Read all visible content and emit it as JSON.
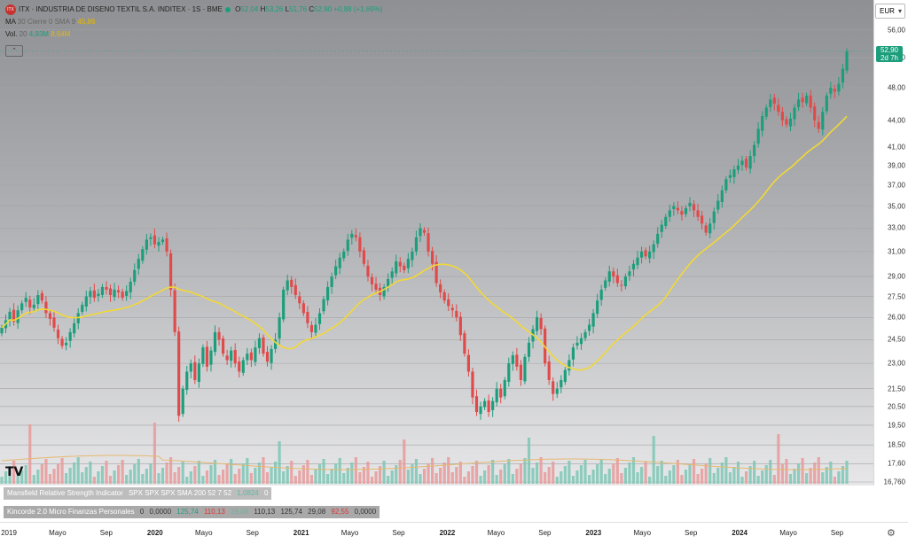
{
  "header": {
    "symbol_title": "ITX · INDUSTRIA DE DISENO TEXTIL S.A. INDITEX · 1S · BME",
    "logo_text": "ITX",
    "o_label": "O",
    "o_value": "52,04",
    "h_label": "H",
    "h_value": "53,26",
    "l_label": "L",
    "l_value": "51,76",
    "c_label": "C",
    "c_value": "52,90",
    "change": "+0,88 (+1,69%)",
    "ma_label": "MA",
    "ma_params": "30 Cierre 0 SMA 9",
    "ma_value": "45,86",
    "vol_label": "Vol.",
    "vol_param": "20",
    "vol_value1": "4,93M",
    "vol_value2": "8,64M",
    "collapse_icon": "chevron-up"
  },
  "currency": "EUR",
  "last_price": "52,90",
  "countdown": "2d 7h",
  "y_ticks": [
    "56,00",
    "52,00",
    "48,00",
    "44,00",
    "41,00",
    "39,00",
    "37,00",
    "35,00",
    "33,00",
    "31,00",
    "29,00",
    "27,50",
    "26,00",
    "24,50",
    "23,00",
    "21,50",
    "20,50",
    "19,50",
    "18,50",
    "17,60",
    "16,760"
  ],
  "x_ticks": [
    {
      "label": "2019",
      "bold": false
    },
    {
      "label": "Mayo",
      "bold": false
    },
    {
      "label": "Sep",
      "bold": false
    },
    {
      "label": "2020",
      "bold": true
    },
    {
      "label": "Mayo",
      "bold": false
    },
    {
      "label": "Sep",
      "bold": false
    },
    {
      "label": "2021",
      "bold": true
    },
    {
      "label": "Mayo",
      "bold": false
    },
    {
      "label": "Sep",
      "bold": false
    },
    {
      "label": "2022",
      "bold": true
    },
    {
      "label": "Mayo",
      "bold": false
    },
    {
      "label": "Sep",
      "bold": false
    },
    {
      "label": "2023",
      "bold": true
    },
    {
      "label": "Mayo",
      "bold": false
    },
    {
      "label": "Sep",
      "bold": false
    },
    {
      "label": "2024",
      "bold": true
    },
    {
      "label": "Mayo",
      "bold": false
    },
    {
      "label": "Sep",
      "bold": false
    }
  ],
  "indicators": {
    "mansfield": {
      "name": "Mansfield Relative Strength Indicator",
      "params": "SPX SPX SPX SMA 200 52 7 52",
      "value": "1,0824",
      "extra": "0"
    },
    "kincorde": {
      "name": "Kincorde 2.0 Micro Finanzas Personales",
      "v1": "0",
      "v2": "0,0000",
      "v3": "125,74",
      "v4": "110,13",
      "v5": "29,08",
      "v6": "110,13",
      "v7": "125,74",
      "v8": "29,08",
      "v9": "92,55",
      "v10": "0,0000"
    }
  },
  "logo_mark": "TV",
  "settings_icon": "gear",
  "colors": {
    "up": "#1c9e7c",
    "down": "#e04a4a",
    "ma": "#f2d835",
    "vol_up": "#7cc7b5",
    "vol_down": "#e89a9a",
    "vol_ma": "#e6b870"
  },
  "chart_data": {
    "type": "candlestick",
    "title": "ITX · INDUSTRIA DE DISENO TEXTIL S.A. INDITEX · 1S · BME",
    "ylim": [
      16.76,
      56.5
    ],
    "y_scale": "log",
    "interval": "1 week",
    "x_range": [
      "2018-12",
      "2024-10"
    ],
    "close_series": [
      25.3,
      25.8,
      26.4,
      25.7,
      26.5,
      27.0,
      27.4,
      26.7,
      26.9,
      27.6,
      27.2,
      26.3,
      25.9,
      25.3,
      24.6,
      24.1,
      24.3,
      25.0,
      25.6,
      26.3,
      26.9,
      27.5,
      27.9,
      27.4,
      27.7,
      28.2,
      28.0,
      27.6,
      28.0,
      27.8,
      27.4,
      27.9,
      28.6,
      29.5,
      30.4,
      31.2,
      32.0,
      32.2,
      31.6,
      31.8,
      32.0,
      31.0,
      28.0,
      25.0,
      20.0,
      21.5,
      22.5,
      23.0,
      22.0,
      23.0,
      24.0,
      22.8,
      23.8,
      25.0,
      24.5,
      23.6,
      23.2,
      23.8,
      23.0,
      22.5,
      23.2,
      23.6,
      23.2,
      24.0,
      24.6,
      23.6,
      23.1,
      23.9,
      24.5,
      26.0,
      28.0,
      28.7,
      28.2,
      27.6,
      27.0,
      26.3,
      25.6,
      25.0,
      25.5,
      26.3,
      27.3,
      28.2,
      29.0,
      29.8,
      30.5,
      31.0,
      32.0,
      32.5,
      32.2,
      31.0,
      30.0,
      29.0,
      28.4,
      28.0,
      27.6,
      28.2,
      28.8,
      29.4,
      30.2,
      29.8,
      29.5,
      30.4,
      31.0,
      32.2,
      33.0,
      32.6,
      31.0,
      30.0,
      28.5,
      27.8,
      27.2,
      26.8,
      26.5,
      26.0,
      24.8,
      23.6,
      22.5,
      21.0,
      20.2,
      20.5,
      20.8,
      20.2,
      20.8,
      21.5,
      21.0,
      22.0,
      23.0,
      23.5,
      22.8,
      22.0,
      23.4,
      24.3,
      25.2,
      26.0,
      25.2,
      23.0,
      22.0,
      21.2,
      21.5,
      22.0,
      22.6,
      23.2,
      24.0,
      24.3,
      24.6,
      25.0,
      25.5,
      26.3,
      27.2,
      28.0,
      28.7,
      29.4,
      29.0,
      28.5,
      28.3,
      29.0,
      29.4,
      30.0,
      30.5,
      31.0,
      30.6,
      31.0,
      31.6,
      32.5,
      33.3,
      34.0,
      34.6,
      35.0,
      34.6,
      34.2,
      34.8,
      35.3,
      34.6,
      34.0,
      33.4,
      32.6,
      33.4,
      34.5,
      35.5,
      36.5,
      37.6,
      38.0,
      38.6,
      39.0,
      39.5,
      38.8,
      40.0,
      41.2,
      43.0,
      44.5,
      45.5,
      46.5,
      46.0,
      45.0,
      44.0,
      43.5,
      44.2,
      45.5,
      46.5,
      46.2,
      47.0,
      45.5,
      44.0,
      43.0,
      45.0,
      47.0,
      48.0,
      47.5,
      48.5,
      50.5,
      52.9
    ],
    "ma": {
      "name": "MA",
      "period": 30,
      "last": 45.86
    },
    "volume": {
      "last": "4,93M",
      "ma_last": "8,64M"
    },
    "last": {
      "open": 52.04,
      "high": 53.26,
      "low": 51.76,
      "close": 52.9,
      "change": 0.88,
      "change_pct": 1.69
    }
  }
}
